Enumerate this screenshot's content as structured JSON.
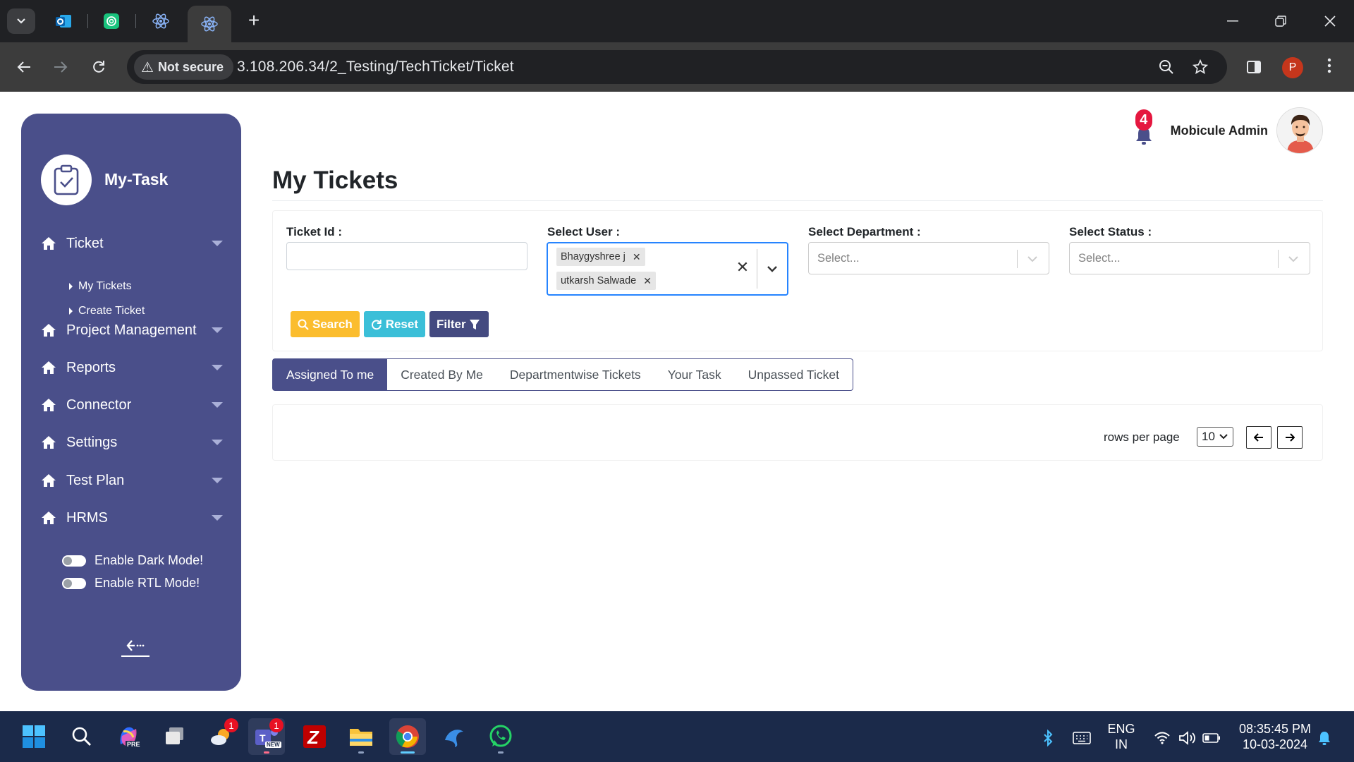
{
  "browser": {
    "url_host": "3.108.206.34",
    "url_path": "/2_Testing/TechTicket/Ticket",
    "security_label": "Not secure"
  },
  "sidebar": {
    "brand": "My-Task",
    "menu": [
      {
        "label": "Ticket"
      },
      {
        "label": "Project Management"
      },
      {
        "label": "Reports"
      },
      {
        "label": "Connector"
      },
      {
        "label": "Settings"
      },
      {
        "label": "Test Plan"
      },
      {
        "label": "HRMS"
      }
    ],
    "ticket_subitems": [
      "My Tickets",
      "Create Ticket"
    ],
    "dark_mode_label": "Enable Dark Mode!",
    "rtl_mode_label": "Enable RTL Mode!"
  },
  "header": {
    "notification_count": "4",
    "user_name": "Mobicule Admin"
  },
  "page": {
    "title": "My Tickets"
  },
  "filters": {
    "ticket_id_label": "Ticket Id :",
    "ticket_id_value": "",
    "user_label": "Select User :",
    "selected_users": [
      "Bhaygyshree j",
      "utkarsh Salwade"
    ],
    "department_label": "Select Department :",
    "department_placeholder": "Select...",
    "status_label": "Select Status :",
    "status_placeholder": "Select...",
    "search_button": "Search",
    "reset_button": "Reset",
    "filter_button": "Filter"
  },
  "tabs": [
    "Assigned To me",
    "Created By Me",
    "Departmentwise Tickets",
    "Your Task",
    "Unpassed Ticket"
  ],
  "active_tab": "Assigned To me",
  "pagination": {
    "rows_per_page_label": "rows per page",
    "rows_per_page_value": "10"
  },
  "taskbar": {
    "language_line1": "ENG",
    "language_line2": "IN",
    "time": "08:35:45 PM",
    "date": "10-03-2024",
    "badges": {
      "weather": "1",
      "teams": "1"
    },
    "teams_tag": "NEW",
    "copilot_tag": "PRE"
  },
  "colors": {
    "sidebar_bg": "#4a4f8a",
    "search_btn": "#fbbd2e",
    "reset_btn": "#3bbfd8",
    "filter_btn": "#444a80",
    "select_focus": "#2684ff",
    "notification_badge": "#e5173f"
  },
  "icons": {
    "tabs": [
      "tab-list-icon",
      "outlook-icon",
      "chatgpt-icon",
      "react-icon",
      "react-icon"
    ],
    "sidebar": [
      "clipboard-check-icon",
      "home-icon",
      "collapse-arrow-icon"
    ],
    "buttons": [
      "search-icon",
      "refresh-icon",
      "funnel-icon"
    ],
    "pagination": [
      "arrow-left-icon",
      "arrow-right-icon"
    ]
  }
}
